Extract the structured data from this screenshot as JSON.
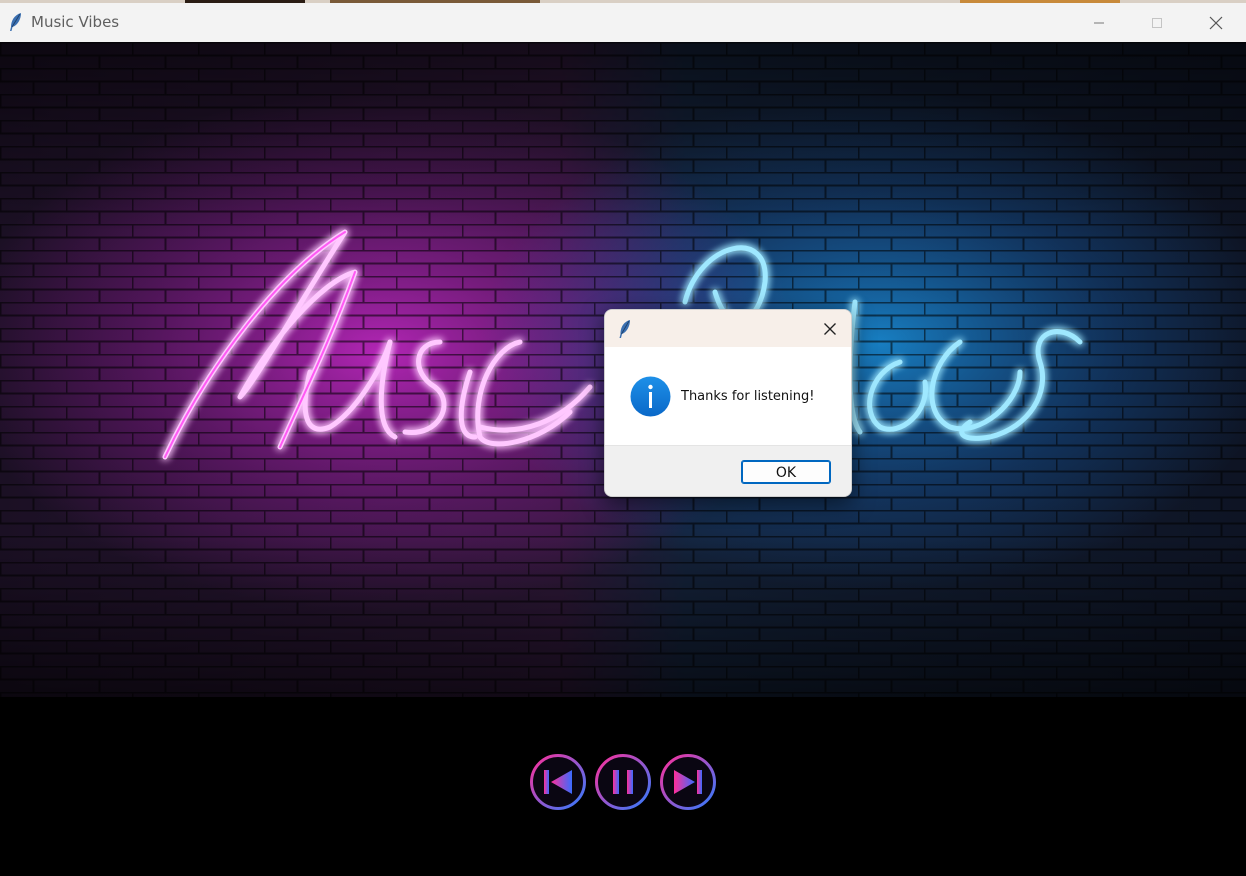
{
  "window": {
    "title": "Music Vibes"
  },
  "hero": {
    "neon_word_left": "Music",
    "neon_word_right": "Vibes",
    "colors": {
      "left_glow": "#ff3df0",
      "right_glow": "#39c6ff",
      "wall": "#2a1830"
    }
  },
  "controls": {
    "icons": [
      "skip-previous-icon",
      "pause-icon",
      "skip-next-icon"
    ],
    "colors": {
      "ring_start": "#ff2f9a",
      "ring_end": "#2f7cff"
    }
  },
  "dialog": {
    "message": "Thanks for listening!",
    "ok_label": "OK",
    "icon": "info-icon",
    "accent": "#0067c0"
  }
}
